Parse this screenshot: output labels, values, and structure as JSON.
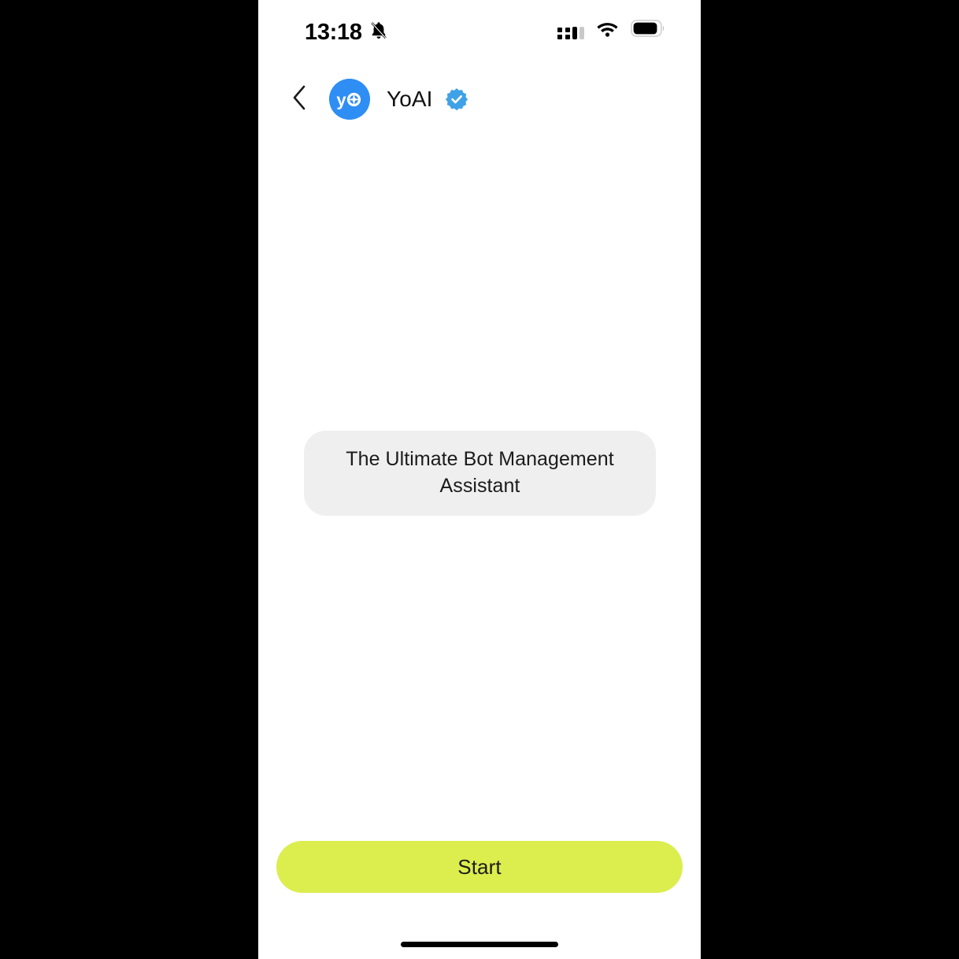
{
  "status_bar": {
    "time": "13:18",
    "notifications_icon": "bell-muted-icon",
    "signal_icon": "cellular-signal-icon",
    "wifi_icon": "wifi-icon",
    "battery_icon": "battery-icon",
    "battery_level_percent": 80
  },
  "header": {
    "back_label": "Back",
    "avatar_icon": "yoai-logo-avatar",
    "avatar_text": "yo",
    "title": "YoAI",
    "verified_icon": "verified-badge-icon"
  },
  "conversation": {
    "messages": [
      {
        "sender": "bot",
        "text": "The Ultimate Bot Management Assistant"
      }
    ]
  },
  "footer": {
    "start_label": "Start"
  },
  "colors": {
    "brand_blue": "#2f8ef4",
    "verified_blue": "#3fa2e8",
    "accent_lime": "#dced4e",
    "bubble_gray": "#efefef",
    "text_dark": "#1b1b1b",
    "page_background": "#ffffff",
    "canvas_background": "#000000"
  }
}
